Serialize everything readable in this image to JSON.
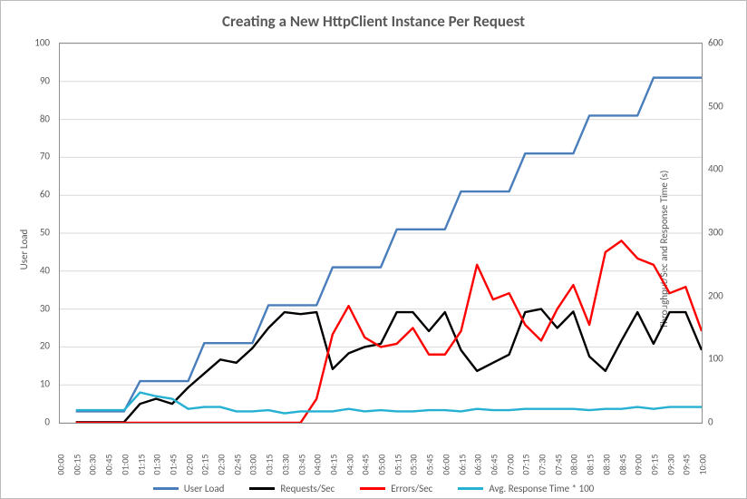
{
  "chart_data": {
    "type": "line",
    "title": "Creating a New HttpClient Instance Per Request",
    "xlabel": "",
    "ylabel_left": "User Load",
    "ylabel_right": "Throughput/Sec and Response Time (s)",
    "ylim_left": [
      0,
      100
    ],
    "ylim_right": [
      0,
      600
    ],
    "y_left_ticks": [
      0,
      10,
      20,
      30,
      40,
      50,
      60,
      70,
      80,
      90,
      100
    ],
    "y_right_ticks": [
      0,
      100,
      200,
      300,
      400,
      500,
      600
    ],
    "categories": [
      "00:00",
      "00:15",
      "00:30",
      "00:45",
      "01:00",
      "01:15",
      "01:30",
      "01:45",
      "02:00",
      "02:15",
      "02:30",
      "02:45",
      "03:00",
      "03:15",
      "03:30",
      "03:45",
      "04:00",
      "04:15",
      "04:30",
      "04:45",
      "05:00",
      "05:15",
      "05:30",
      "05:45",
      "06:00",
      "06:15",
      "06:30",
      "06:45",
      "07:00",
      "07:15",
      "07:30",
      "07:45",
      "08:00",
      "08:15",
      "08:30",
      "08:45",
      "09:00",
      "09:15",
      "09:30",
      "09:45",
      "10:00"
    ],
    "series": [
      {
        "name": "User  Load",
        "color": "#4a7ebb",
        "axis": "left",
        "values": [
          null,
          3,
          3,
          3,
          3,
          11,
          11,
          11,
          11,
          21,
          21,
          21,
          21,
          31,
          31,
          31,
          31,
          41,
          41,
          41,
          41,
          51,
          51,
          51,
          51,
          61,
          61,
          61,
          61,
          71,
          71,
          71,
          71,
          81,
          81,
          81,
          81,
          91,
          91,
          91,
          91
        ]
      },
      {
        "name": "Requests/Sec",
        "color": "#000000",
        "axis": "right",
        "values": [
          null,
          1,
          1,
          1,
          1,
          30,
          38,
          30,
          56,
          78,
          100,
          95,
          118,
          150,
          175,
          172,
          175,
          85,
          110,
          120,
          125,
          175,
          175,
          145,
          175,
          115,
          82,
          95,
          108,
          175,
          180,
          150,
          176,
          105,
          82,
          130,
          175,
          125,
          175,
          175,
          115
        ]
      },
      {
        "name": "Errors/Sec",
        "color": "#ff0000",
        "axis": "right",
        "values": [
          null,
          0,
          0,
          0,
          0,
          0,
          0,
          0,
          0,
          0,
          0,
          0,
          0,
          0,
          0,
          0,
          38,
          140,
          185,
          135,
          120,
          125,
          150,
          108,
          108,
          145,
          250,
          195,
          205,
          155,
          130,
          180,
          218,
          155,
          270,
          288,
          260,
          250,
          205,
          215,
          145
        ]
      },
      {
        "name": "Avg. Response Time * 100",
        "color": "#26b0d3",
        "axis": "right",
        "values": [
          null,
          20,
          20,
          20,
          20,
          48,
          42,
          38,
          22,
          25,
          25,
          18,
          18,
          20,
          15,
          18,
          18,
          18,
          22,
          18,
          20,
          18,
          18,
          20,
          20,
          18,
          22,
          20,
          20,
          22,
          22,
          22,
          22,
          20,
          22,
          22,
          25,
          22,
          25,
          25,
          25
        ]
      }
    ],
    "legend_position": "bottom"
  }
}
